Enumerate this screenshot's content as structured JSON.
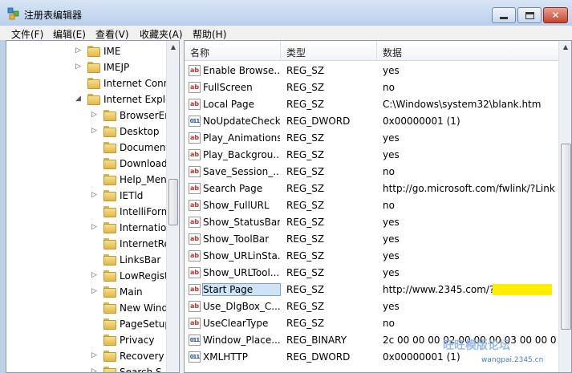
{
  "window": {
    "title": "注册表编辑器"
  },
  "menu": [
    "文件(F)",
    "编辑(E)",
    "查看(V)",
    "收藏夹(A)",
    "帮助(H)"
  ],
  "tree": [
    {
      "label": "IME",
      "indent": 0,
      "expander": "collapsed"
    },
    {
      "label": "IMEJP",
      "indent": 0,
      "expander": "collapsed"
    },
    {
      "label": "Internet Conn",
      "indent": 0,
      "expander": "none"
    },
    {
      "label": "Internet Explo",
      "indent": 0,
      "expander": "expanded"
    },
    {
      "label": "BrowserEm",
      "indent": 1,
      "expander": "collapsed"
    },
    {
      "label": "Desktop",
      "indent": 1,
      "expander": "collapsed"
    },
    {
      "label": "Document",
      "indent": 1,
      "expander": "none"
    },
    {
      "label": "Download",
      "indent": 1,
      "expander": "none"
    },
    {
      "label": "Help_Menu",
      "indent": 1,
      "expander": "none"
    },
    {
      "label": "IETld",
      "indent": 1,
      "expander": "collapsed"
    },
    {
      "label": "IntelliForm",
      "indent": 1,
      "expander": "none"
    },
    {
      "label": "Internatio",
      "indent": 1,
      "expander": "collapsed"
    },
    {
      "label": "InternetRe",
      "indent": 1,
      "expander": "none"
    },
    {
      "label": "LinksBar",
      "indent": 1,
      "expander": "none"
    },
    {
      "label": "LowRegist",
      "indent": 1,
      "expander": "collapsed"
    },
    {
      "label": "Main",
      "indent": 1,
      "expander": "collapsed",
      "selected": true
    },
    {
      "label": "New Wind",
      "indent": 1,
      "expander": "none"
    },
    {
      "label": "PageSetup",
      "indent": 1,
      "expander": "none"
    },
    {
      "label": "Privacy",
      "indent": 1,
      "expander": "none"
    },
    {
      "label": "Recovery",
      "indent": 1,
      "expander": "collapsed"
    },
    {
      "label": "Search S",
      "indent": 1,
      "expander": "collapsed"
    }
  ],
  "columns": {
    "name": "名称",
    "type": "类型",
    "data": "数据"
  },
  "values": [
    {
      "icon": "sz",
      "name": "Enable Browse...",
      "type": "REG_SZ",
      "data": "yes"
    },
    {
      "icon": "sz",
      "name": "FullScreen",
      "type": "REG_SZ",
      "data": "no"
    },
    {
      "icon": "sz",
      "name": "Local Page",
      "type": "REG_SZ",
      "data": "C:\\Windows\\system32\\blank.htm"
    },
    {
      "icon": "bin",
      "name": "NoUpdateCheck",
      "type": "REG_DWORD",
      "data": "0x00000001 (1)"
    },
    {
      "icon": "sz",
      "name": "Play_Animations",
      "type": "REG_SZ",
      "data": "yes"
    },
    {
      "icon": "sz",
      "name": "Play_Backgrou...",
      "type": "REG_SZ",
      "data": "yes"
    },
    {
      "icon": "sz",
      "name": "Save_Session_...",
      "type": "REG_SZ",
      "data": "no"
    },
    {
      "icon": "sz",
      "name": "Search Page",
      "type": "REG_SZ",
      "data": "http://go.microsoft.com/fwlink/?LinkId"
    },
    {
      "icon": "sz",
      "name": "Show_FullURL",
      "type": "REG_SZ",
      "data": "no"
    },
    {
      "icon": "sz",
      "name": "Show_StatusBar",
      "type": "REG_SZ",
      "data": "yes"
    },
    {
      "icon": "sz",
      "name": "Show_ToolBar",
      "type": "REG_SZ",
      "data": "yes"
    },
    {
      "icon": "sz",
      "name": "Show_URLinSta...",
      "type": "REG_SZ",
      "data": "yes"
    },
    {
      "icon": "sz",
      "name": "Show_URLTool...",
      "type": "REG_SZ",
      "data": "yes"
    },
    {
      "icon": "sz",
      "name": "Start Page",
      "type": "REG_SZ",
      "data": "http://www.2345.com/?k",
      "selected": true,
      "highlight": true
    },
    {
      "icon": "sz",
      "name": "Use_DlgBox_C...",
      "type": "REG_SZ",
      "data": "yes"
    },
    {
      "icon": "sz",
      "name": "UseClearType",
      "type": "REG_SZ",
      "data": "no"
    },
    {
      "icon": "bin",
      "name": "Window_Place...",
      "type": "REG_BINARY",
      "data": "2c 00 00 00 02 00 00 00 03 00 00 00"
    },
    {
      "icon": "bin",
      "name": "XMLHTTP",
      "type": "REG_DWORD",
      "data": "0x00000001 (1)"
    }
  ],
  "icons": {
    "sz": "ab",
    "bin": "011"
  },
  "watermark": {
    "main": "旺旺模版论坛",
    "sub": "wangpai.2345.cn"
  }
}
